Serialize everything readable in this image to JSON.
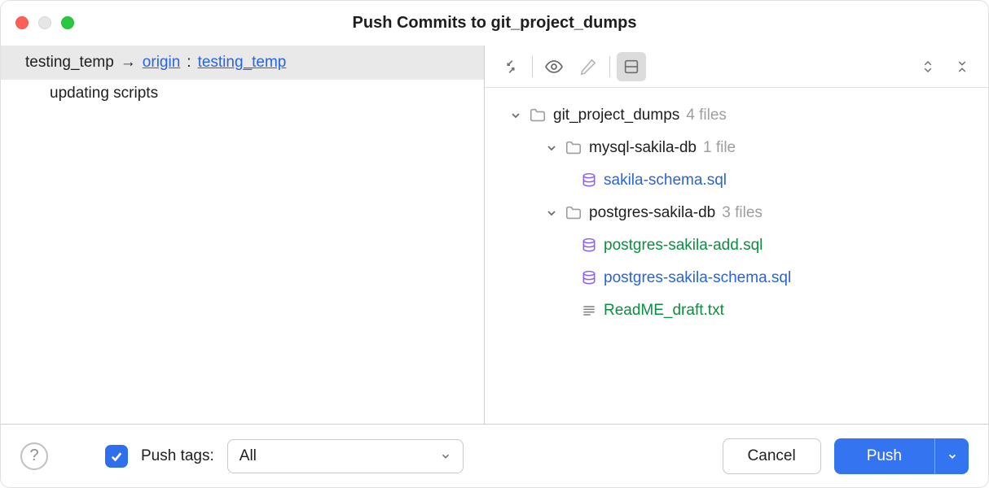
{
  "title": "Push Commits to git_project_dumps",
  "branches": {
    "local": "testing_temp",
    "remote": "origin",
    "remote_branch": "testing_temp",
    "arrow": "→",
    "colon": " : "
  },
  "commits": [
    "updating scripts"
  ],
  "tree": {
    "root": {
      "name": "git_project_dumps",
      "hint": "4 files"
    },
    "mysql": {
      "name": "mysql-sakila-db",
      "hint": "1 file"
    },
    "mysql_files": {
      "sakila_schema": "sakila-schema.sql"
    },
    "postgres": {
      "name": "postgres-sakila-db",
      "hint": "3 files"
    },
    "postgres_files": {
      "add": "postgres-sakila-add.sql",
      "schema": "postgres-sakila-schema.sql",
      "readme": "ReadME_draft.txt"
    }
  },
  "footer": {
    "push_tags_label": "Push tags:",
    "tags_filter": "All",
    "cancel": "Cancel",
    "push": "Push"
  }
}
